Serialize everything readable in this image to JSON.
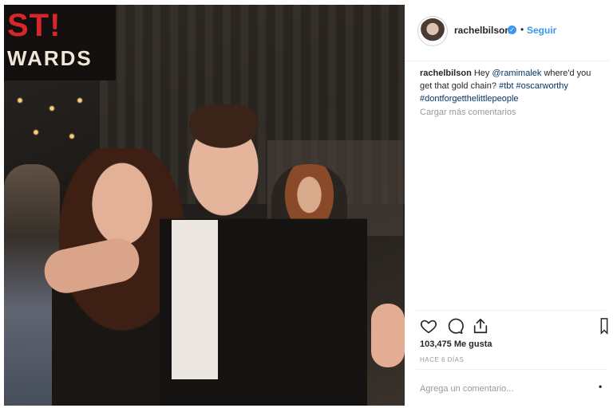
{
  "photo": {
    "sign_line_1": "ST!",
    "sign_line_2": "WARDS"
  },
  "header": {
    "username": "rachelbilson",
    "verified_icon": "verified-badge-icon",
    "separator": "•",
    "follow_label": "Seguir"
  },
  "caption": {
    "username": "rachelbilson",
    "text_1": " Hey ",
    "mention": "@ramimalek",
    "text_2": " where'd you get that gold chain? ",
    "tag_1": "#tbt",
    "tag_2": "#oscarworthy",
    "tag_3": "#dontforgetthelittlepeople"
  },
  "load_more": "Cargar más comentarios",
  "actions": {
    "like_icon": "heart-icon",
    "comment_icon": "comment-icon",
    "share_icon": "share-icon",
    "save_icon": "bookmark-icon"
  },
  "likes": "103,475 Me gusta",
  "time": "HACE 6 DÍAS",
  "comment_input": {
    "placeholder": "Agrega un comentario...",
    "more_label": "•"
  },
  "colors": {
    "link": "#3897f0",
    "text": "#262626",
    "muted": "#999999",
    "divider": "#efefef"
  }
}
